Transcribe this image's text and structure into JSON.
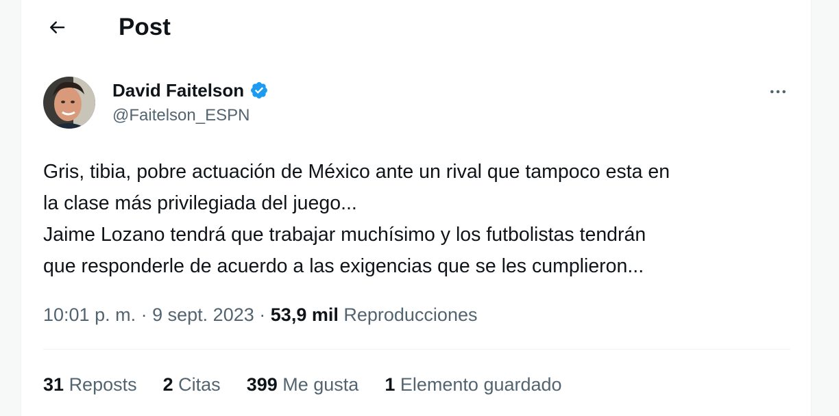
{
  "header": {
    "back_icon": "arrow-left-icon",
    "title": "Post"
  },
  "author": {
    "display_name": "David Faitelson",
    "handle": "@Faitelson_ESPN",
    "verified_icon": "verified-badge-icon",
    "verified_color": "#1d9bf0"
  },
  "more_icon": "more-horizontal-icon",
  "tweet": {
    "lines": [
      "Gris, tibia, pobre actuación de México ante un rival que tampoco esta en",
      "la clase más privilegiada del juego...",
      "Jaime Lozano tendrá que trabajar muchísimo y los futbolistas tendrán",
      "que responderle de acuerdo a las exigencias que se les cumplieron..."
    ]
  },
  "meta": {
    "time": "10:01 p. m.",
    "sep1": "·",
    "date": "9 sept. 2023",
    "sep2": "·",
    "views_count": "53,9 mil",
    "views_label": "Reproducciones"
  },
  "stats": {
    "reposts_count": "31",
    "reposts_label": "Reposts",
    "quotes_count": "2",
    "quotes_label": "Citas",
    "likes_count": "399",
    "likes_label": "Me gusta",
    "bookmarks_count": "1",
    "bookmarks_label": "Elemento guardado"
  },
  "colors": {
    "text_primary": "#0f1419",
    "text_secondary": "#536471",
    "divider": "#eff3f4"
  }
}
